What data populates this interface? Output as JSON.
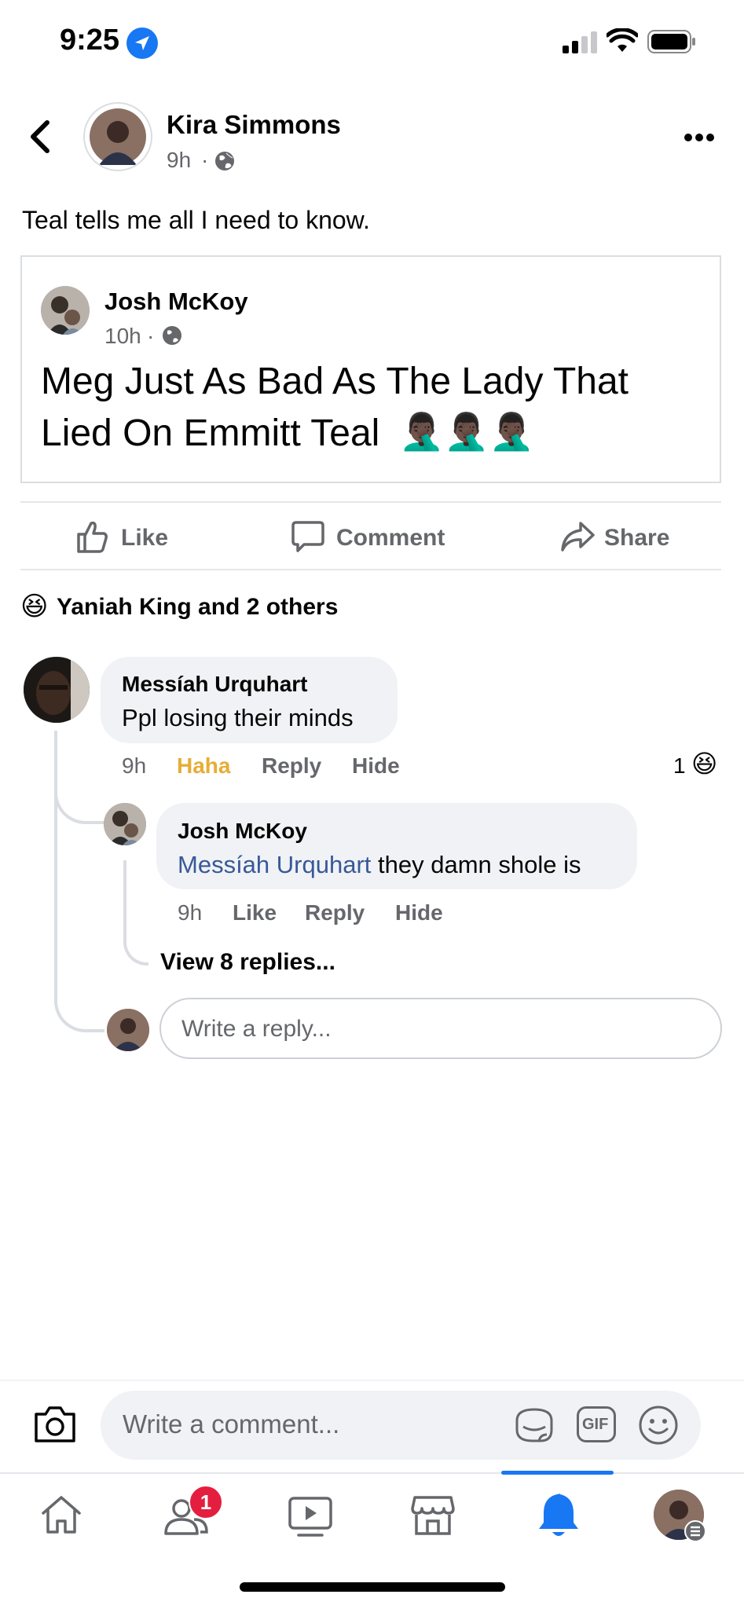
{
  "status_bar": {
    "time": "9:25"
  },
  "post": {
    "author": "Kira Simmons",
    "time": "9h",
    "separator": "·",
    "text": "Teal tells me all I need to know."
  },
  "shared_post": {
    "author": "Josh McKoy",
    "time": "10h",
    "separator": "·",
    "text_line1": "Meg Just As Bad As The Lady That",
    "text_line2": "Lied On Emmitt Teal",
    "emoji": "🤦🏿‍♂️🤦🏿‍♂️🤦🏿‍♂️"
  },
  "actions": {
    "like": "Like",
    "comment": "Comment",
    "share": "Share"
  },
  "reactions": {
    "emoji": "😆",
    "summary": "Yaniah King and 2 others"
  },
  "comment1": {
    "author": "Messíah Urquhart",
    "text": "Ppl losing their minds",
    "time": "9h",
    "reaction_label": "Haha",
    "reply": "Reply",
    "hide": "Hide",
    "reaction_count": "1",
    "reaction_emoji": "😆"
  },
  "reply1": {
    "author": "Josh McKoy",
    "mention": "Messíah Urquhart",
    "text": " they damn shole is",
    "time": "9h",
    "like": "Like",
    "reply": "Reply",
    "hide": "Hide"
  },
  "view_replies": "View 8 replies...",
  "reply_input": {
    "placeholder": "Write a reply..."
  },
  "comment_bar": {
    "placeholder": "Write a comment...",
    "gif": "GIF"
  },
  "nav": {
    "friends_badge": "1"
  },
  "colors": {
    "accent": "#1877f2",
    "haha": "#e6ad36",
    "mention": "#385898",
    "badge": "#e41e3f"
  }
}
